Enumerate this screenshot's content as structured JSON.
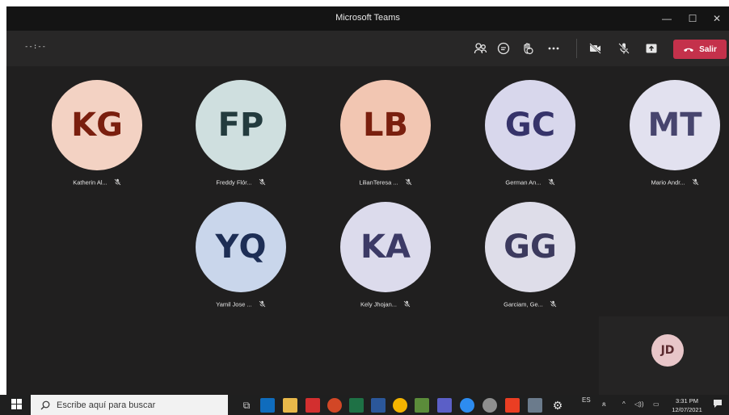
{
  "window": {
    "title": "Microsoft Teams"
  },
  "toolbar": {
    "timer": "--:--",
    "leave_label": "Salir",
    "leave_color": "#c4314b"
  },
  "participants": [
    {
      "initials": "KG",
      "name": "Katherin Al...",
      "bg": "#f3d2c3",
      "fg": "#7a1f0e"
    },
    {
      "initials": "FP",
      "name": "Freddy Flór...",
      "bg": "#cfdfdf",
      "fg": "#233b3e"
    },
    {
      "initials": "LB",
      "name": "LilianTeresa ...",
      "bg": "#f2c6b2",
      "fg": "#7a1f0e"
    },
    {
      "initials": "GC",
      "name": "German An...",
      "bg": "#d8d7ec",
      "fg": "#36336a"
    },
    {
      "initials": "MT",
      "name": "Mario Andr...",
      "bg": "#e2e1ef",
      "fg": "#47456e"
    },
    {
      "initials": "YQ",
      "name": "Yamil Jose ...",
      "bg": "#c9d6eb",
      "fg": "#1d2e55"
    },
    {
      "initials": "KA",
      "name": "Kely Jhojan...",
      "bg": "#dcdbec",
      "fg": "#3c3a66"
    },
    {
      "initials": "GG",
      "name": "Garciam, Ge...",
      "bg": "#dedde9",
      "fg": "#3c3a5e"
    }
  ],
  "self_view": {
    "initials": "JD"
  },
  "taskbar": {
    "search_placeholder": "Escribe aquí para buscar",
    "lang": "ES",
    "time": "3:31 PM",
    "date": "12/07/2021"
  }
}
